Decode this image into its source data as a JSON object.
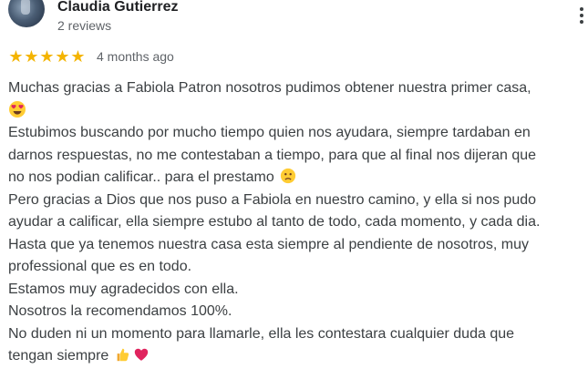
{
  "review": {
    "author": {
      "name": "Claudia Gutierrez",
      "reviews_count": "2 reviews"
    },
    "rating": 5,
    "date": "4 months ago",
    "lines": [
      "Muchas gracias a Fabiola Patron nosotros pudimos obtener nuestra primer casa,",
      "Estubimos buscando por mucho tiempo quien nos ayudara, siempre tardaban en",
      "darnos respuestas, no me contestaban a tiempo, para que al final nos dijeran que",
      "no nos podian calificar.. para el prestamo",
      "Pero gracias a Dios que nos puso a Fabiola en nuestro camino, y ella si nos pudo",
      "ayudar a calificar, ella siempre estubo al tanto de todo, cada momento, y cada dia.",
      "Hasta que ya tenemos nuestra casa esta siempre al pendiente de nosotros, muy",
      "professional que es en todo.",
      "Estamos muy agradecidos con ella.",
      "Nosotros la recomendamos 100%.",
      "No duden ni un momento para llamarle, ella les contestara cualquier duda que",
      "tengan siempre"
    ],
    "emojis": [
      "heart-eyes-emoji",
      "sad-face-emoji",
      "thumbs-up-emoji",
      "heart-emoji"
    ]
  },
  "colors": {
    "star": "#f4b400",
    "heart": "#e0245e"
  },
  "icons": {
    "more": "more-vert-icon"
  }
}
